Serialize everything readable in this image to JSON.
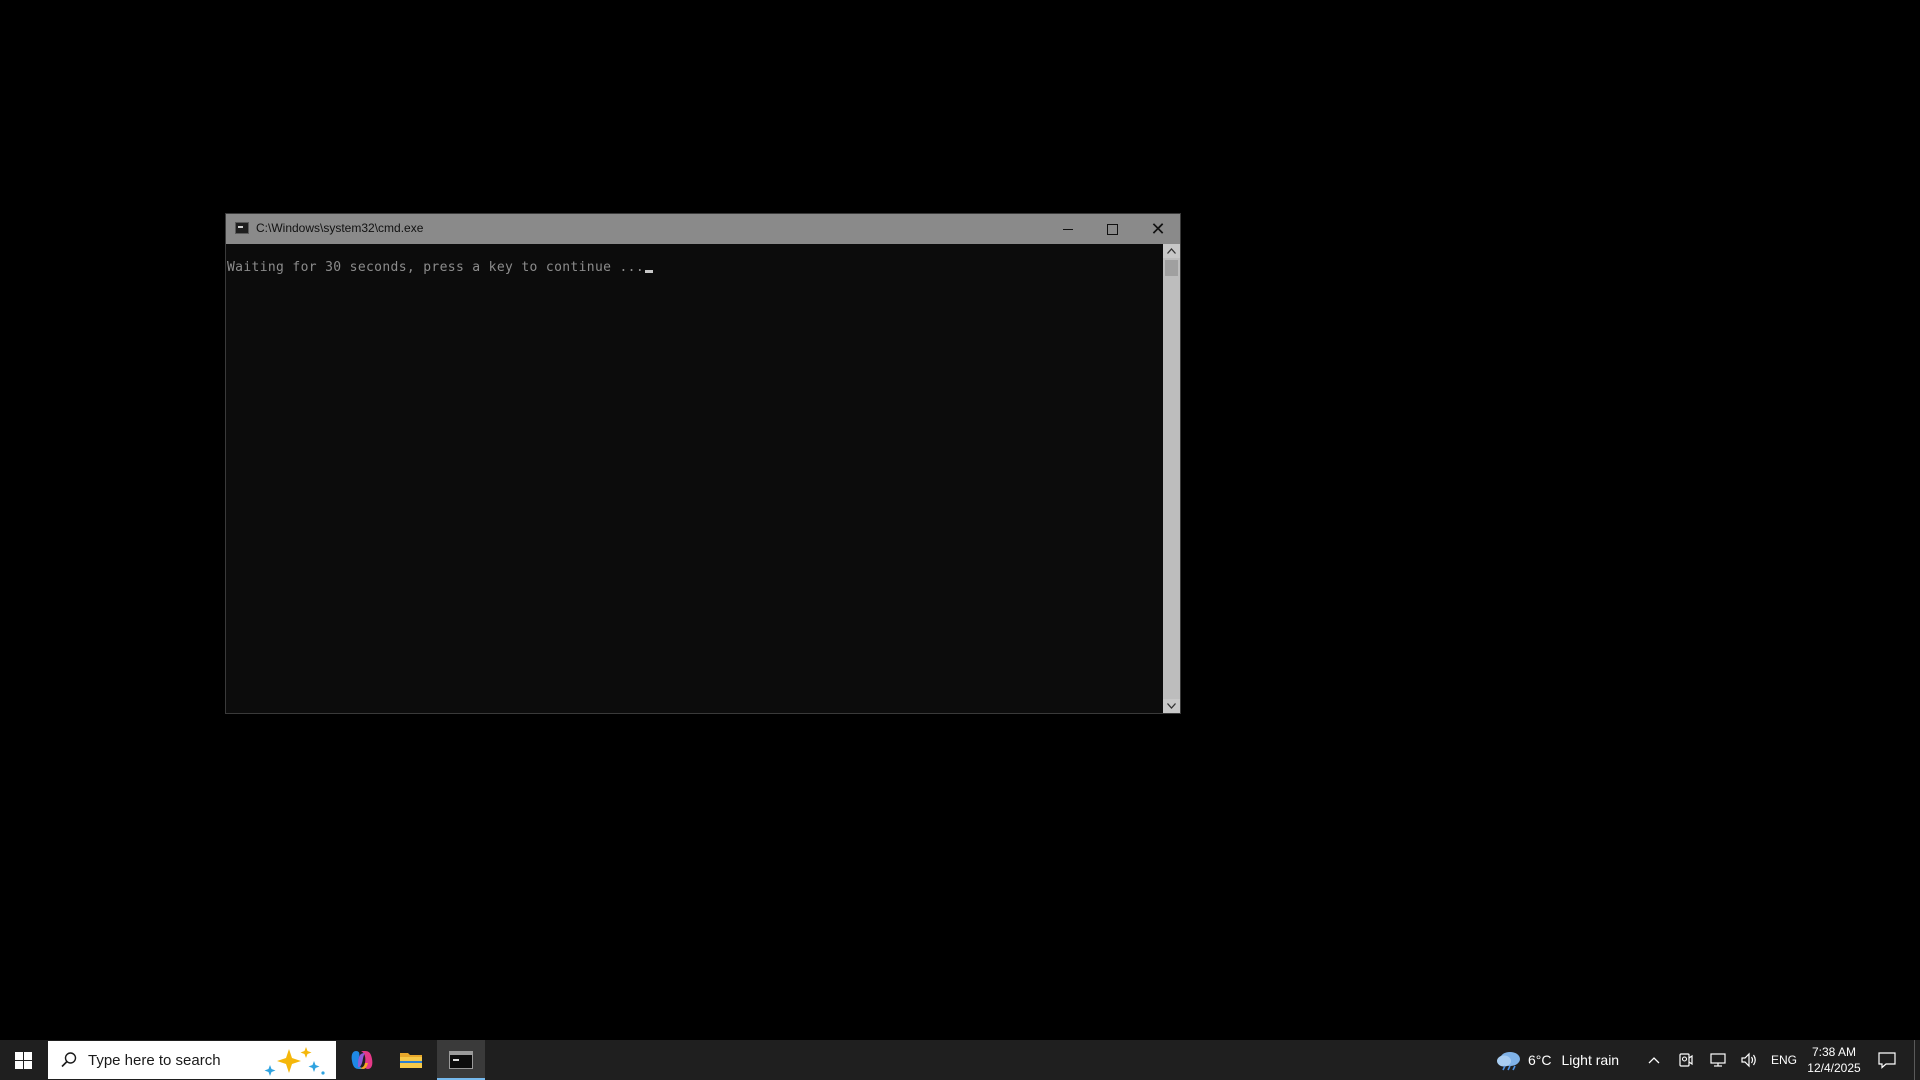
{
  "window": {
    "title": "C:\\Windows\\system32\\cmd.exe",
    "console_text": "Waiting for 30 seconds, press a key to continue ..."
  },
  "taskbar": {
    "search_placeholder": "Type here to search",
    "apps": [
      {
        "name": "Copilot",
        "icon": "copilot-icon"
      },
      {
        "name": "File Explorer",
        "icon": "folder-icon"
      },
      {
        "name": "Command Prompt",
        "icon": "cmd-icon",
        "active": true
      }
    ],
    "weather": {
      "temperature": "6°C",
      "condition": "Light rain",
      "icon": "cloud-rain-icon"
    },
    "language": "ENG",
    "clock": {
      "time": "7:38 AM",
      "date": "12/4/2025"
    }
  },
  "colors": {
    "desktop": "#000000",
    "console_bg": "#0c0c0c",
    "console_text": "#8c8c8c",
    "titlebar": "#8a8a8a",
    "taskbar": "#1f1f1f",
    "active_underline": "#76b9ed"
  }
}
